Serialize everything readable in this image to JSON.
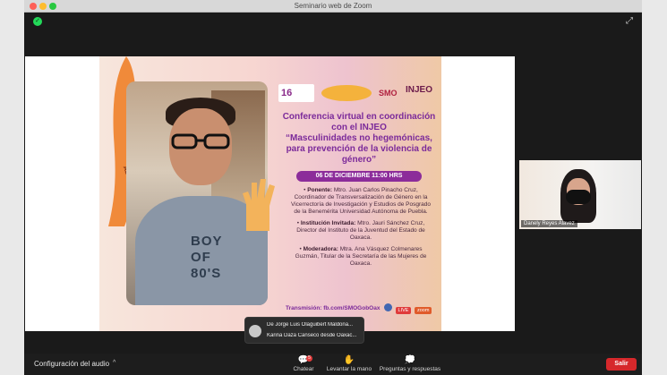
{
  "window": {
    "title": "Seminario web de Zoom"
  },
  "slide": {
    "logos": {
      "l16": "16",
      "smo": "SMO",
      "injeo": "INJEO"
    },
    "shirt_text": "BOY\nOF\n80'S",
    "alto_left": "ALTO",
    "conference": "Conferencia virtual en coordinación con el INJEO",
    "topic": "“Masculinidades no hegemónicas, para prevención de la violencia de género”",
    "date": "06 DE DICIEMBRE 11:00 HRS",
    "ponente_label": "Ponente:",
    "ponente_text": "Mtro. Juan Carlos Pinacho Cruz, Coordinador de Transversalización de Género en la Vicerrectoría de Investigación y Estudios de Posgrado de la Benemérita Universidad Autónoma de Puebla.",
    "invitada_label": "Institución Invitada:",
    "invitada_text": "Mtro. Jauri Sánchez Cruz, Director del Instituto de la Juventud del Estado de Oaxaca.",
    "moderadora_label": "Moderadora:",
    "moderadora_text": "Mtra. Ana Vásquez Colmenares Guzmán, Titular de la Secretaría de las Mujeres de Oaxaca.",
    "transmision": "Transmisión: fb.com/SMOGobOax",
    "badge_live": "LIVE",
    "badge_zoom": "zoom"
  },
  "participant": {
    "name": "Danely Reyes Alavez"
  },
  "chat_bubble": {
    "line1": "De Jorge Luis Olaguibert Maldona...",
    "line2": "Karina Daza Canseco desde Oaxac..."
  },
  "toolbar": {
    "audio_label": "Configuración del audio",
    "chat_label": "Chatear",
    "chat_count": "5",
    "raise_label": "Levantar la mano",
    "qa_label": "Preguntas y respuestas",
    "leave_label": "Salir"
  }
}
